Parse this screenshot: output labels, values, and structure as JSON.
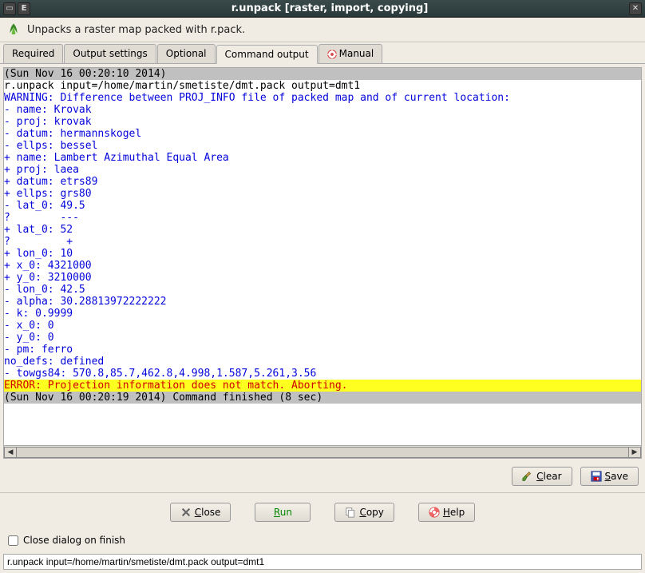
{
  "window": {
    "title": "r.unpack [raster, import, copying]",
    "description": "Unpacks a raster map packed with r.pack."
  },
  "tabs": [
    {
      "label": "Required"
    },
    {
      "label": "Output settings"
    },
    {
      "label": "Optional"
    },
    {
      "label": "Command output",
      "active": true
    },
    {
      "label": "Manual",
      "icon": "help-icon"
    }
  ],
  "output": {
    "lines": [
      {
        "cls": "gray-line",
        "text": "(Sun Nov 16 00:20:10 2014)                                                      "
      },
      {
        "cls": "plain-line",
        "text": "r.unpack input=/home/martin/smetiste/dmt.pack output=dmt1                       "
      },
      {
        "cls": "blue-line",
        "text": "WARNING: Difference between PROJ_INFO file of packed map and of current location:"
      },
      {
        "cls": "blue-line",
        "text": "- name: Krovak"
      },
      {
        "cls": "blue-line",
        "text": "- proj: krovak"
      },
      {
        "cls": "blue-line",
        "text": "- datum: hermannskogel"
      },
      {
        "cls": "blue-line",
        "text": "- ellps: bessel"
      },
      {
        "cls": "blue-line",
        "text": "+ name: Lambert Azimuthal Equal Area"
      },
      {
        "cls": "blue-line",
        "text": "+ proj: laea"
      },
      {
        "cls": "blue-line",
        "text": "+ datum: etrs89"
      },
      {
        "cls": "blue-line",
        "text": "+ ellps: grs80"
      },
      {
        "cls": "blue-line",
        "text": "- lat_0: 49.5"
      },
      {
        "cls": "blue-line",
        "text": "?        ---"
      },
      {
        "cls": "blue-line",
        "text": "+ lat_0: 52"
      },
      {
        "cls": "blue-line",
        "text": "?         +"
      },
      {
        "cls": "blue-line",
        "text": "+ lon_0: 10"
      },
      {
        "cls": "blue-line",
        "text": "+ x_0: 4321000"
      },
      {
        "cls": "blue-line",
        "text": "+ y_0: 3210000"
      },
      {
        "cls": "blue-line",
        "text": "- lon_0: 42.5"
      },
      {
        "cls": "blue-line",
        "text": "- alpha: 30.28813972222222"
      },
      {
        "cls": "blue-line",
        "text": "- k: 0.9999"
      },
      {
        "cls": "blue-line",
        "text": "- x_0: 0"
      },
      {
        "cls": "blue-line",
        "text": "- y_0: 0"
      },
      {
        "cls": "blue-line",
        "text": "- pm: ferro"
      },
      {
        "cls": "blue-line",
        "text": "no_defs: defined"
      },
      {
        "cls": "blue-line",
        "text": "- towgs84: 570.8,85.7,462.8,4.998,1.587,5.261,3.56"
      },
      {
        "cls": "err-line",
        "text": "ERROR: Projection information does not match. Aborting."
      },
      {
        "cls": "gray-line",
        "text": "(Sun Nov 16 00:20:19 2014) Command finished (8 sec)                             "
      }
    ]
  },
  "output_buttons": {
    "clear": "Clear",
    "save": "Save"
  },
  "main_buttons": {
    "close": "Close",
    "run": "Run",
    "copy": "Copy",
    "help": "Help"
  },
  "close_on_finish": "Close dialog on finish",
  "command_text": "r.unpack input=/home/martin/smetiste/dmt.pack output=dmt1"
}
